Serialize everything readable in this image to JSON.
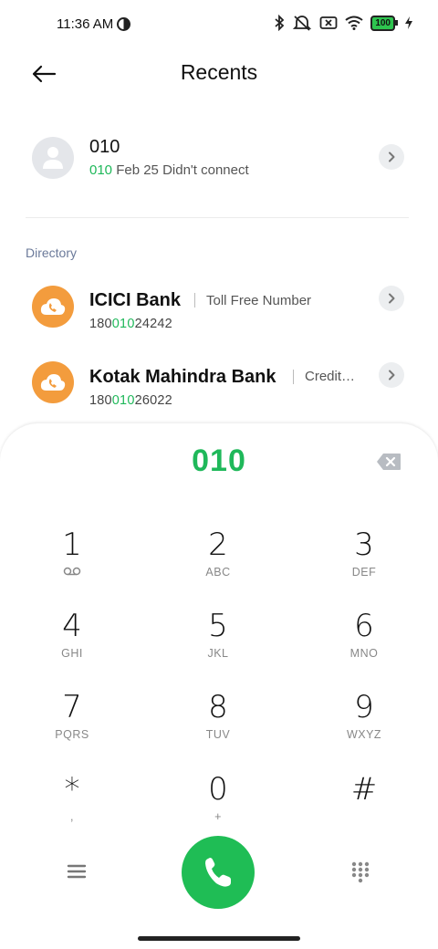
{
  "status_bar": {
    "time": "11:36 AM",
    "battery": "100"
  },
  "header": {
    "title": "Recents",
    "back_icon": "arrow-left-icon"
  },
  "recent": {
    "name": "010",
    "number_prefix": "010",
    "detail": "Feb 25 Didn't connect"
  },
  "directory": {
    "label": "Directory",
    "items": [
      {
        "name": "ICICI Bank",
        "description": "Toll Free Number",
        "number_a": "180",
        "number_match": "010",
        "number_b": "24242"
      },
      {
        "name": "Kotak Mahindra Bank",
        "description": "Credit…",
        "number_a": "180",
        "number_match": "010",
        "number_b": "26022"
      }
    ]
  },
  "dialer": {
    "input": "010",
    "keys": [
      {
        "digit": "1",
        "sub": ""
      },
      {
        "digit": "2",
        "sub": "ABC"
      },
      {
        "digit": "3",
        "sub": "DEF"
      },
      {
        "digit": "4",
        "sub": "GHI"
      },
      {
        "digit": "5",
        "sub": "JKL"
      },
      {
        "digit": "6",
        "sub": "MNO"
      },
      {
        "digit": "7",
        "sub": "PQRS"
      },
      {
        "digit": "8",
        "sub": "TUV"
      },
      {
        "digit": "9",
        "sub": "WXYZ"
      },
      {
        "digit": "*",
        "sub": ","
      },
      {
        "digit": "0",
        "sub": "+"
      },
      {
        "digit": "#",
        "sub": ""
      }
    ]
  },
  "colors": {
    "accent_green": "#1fb85a",
    "directory_icon": "#f39c3d"
  }
}
